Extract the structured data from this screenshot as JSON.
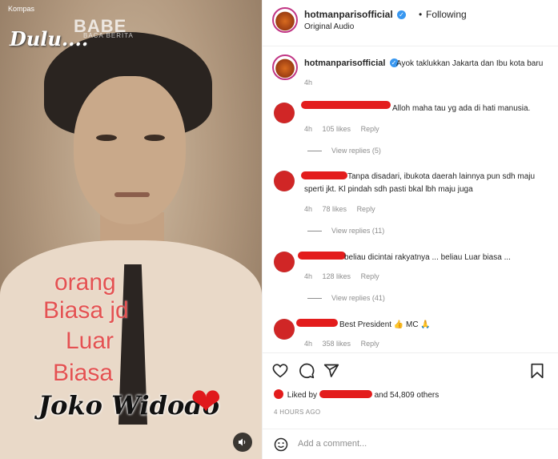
{
  "media": {
    "watermark_top": "Kompas",
    "watermark_dulu": "Dulu....",
    "watermark_brand": "BABE",
    "watermark_brand_sub": "BACA BERITA",
    "caption_lines": [
      "orang",
      "Biasa jd",
      "Luar",
      "Biasa"
    ],
    "name_overlay": "Joko Widodo",
    "heart_glyph": "❤",
    "mute_icon": "speaker-icon"
  },
  "header": {
    "username": "hotmanparisofficial",
    "separator": "•",
    "follow_status": "Following",
    "audio": "Original Audio"
  },
  "post": {
    "username": "hotmanparisofficial",
    "caption": "Ayok taklukkan Jakarta dan Ibu kota baru",
    "time": "4h"
  },
  "comments": [
    {
      "text": "Alloh maha tau yg ada di hati manusia.",
      "time": "4h",
      "likes": "105 likes",
      "reply": "Reply",
      "view_replies": "View replies (5)"
    },
    {
      "text_line1": "Tanpa disadari, ibukota daerah lainnya pun sdh maju",
      "text_line2": "sperti jkt. Kl pindah sdh pasti bkal lbh maju juga",
      "time": "4h",
      "likes": "78 likes",
      "reply": "Reply",
      "view_replies": "View replies (11)"
    },
    {
      "text": "beliau dicintai rakyatnya ... beliau Luar biasa ...",
      "time": "4h",
      "likes": "128 likes",
      "reply": "Reply",
      "view_replies": "View replies (41)"
    },
    {
      "text": "Best President 👍 MC 🙏",
      "time": "4h",
      "likes": "358 likes",
      "reply": "Reply"
    }
  ],
  "likes_summary": {
    "prefix": "Liked by",
    "suffix": "and 54,809 others"
  },
  "time_ago": "4 HOURS AGO",
  "add_comment": {
    "placeholder": "Add a comment..."
  },
  "icons": {
    "like": "heart-icon",
    "comment": "comment-icon",
    "share": "share-icon",
    "save": "bookmark-icon",
    "emoji": "emoji-icon"
  },
  "colors": {
    "redaction": "#e31c1c",
    "verified": "#3897f0",
    "caption_red": "#e45252"
  }
}
